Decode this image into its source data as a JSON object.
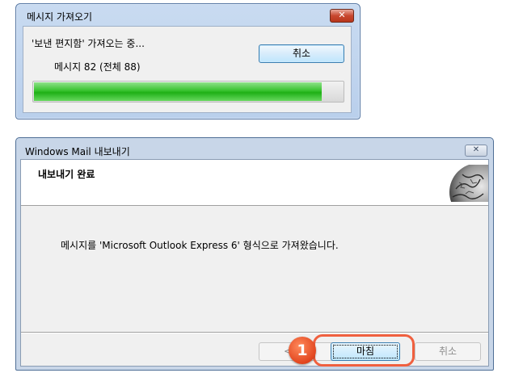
{
  "import_dialog": {
    "title": "메시지 가져오기",
    "close_glyph": "✕",
    "status_line": "'보낸 편지함' 가져오는 중...",
    "progress_text": "메시지 82 (전체 88)",
    "progress_fraction": 0.932,
    "cancel_label": "취소"
  },
  "export_dialog": {
    "title": "Windows Mail 내보내기",
    "close_glyph": "✕",
    "header_title": "내보내기 완료",
    "message": "메시지를 'Microsoft Outlook Express 6' 형식으로 가져왔습니다.",
    "buttons": {
      "back_label": "< 뒤로",
      "finish_label": "마침",
      "cancel_label": "취소"
    }
  },
  "callout": {
    "number": "1",
    "color": "#f0603f"
  }
}
